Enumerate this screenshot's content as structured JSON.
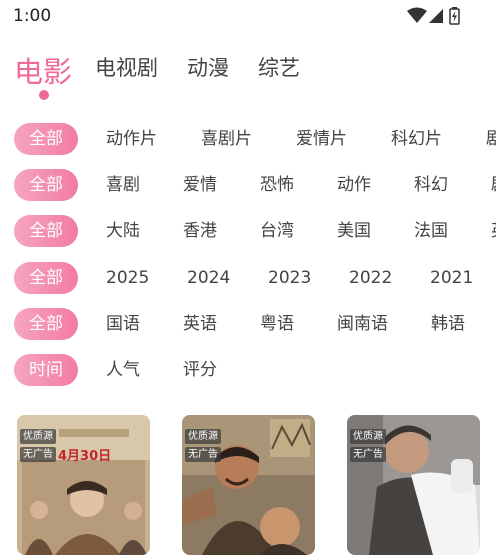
{
  "status_bar": {
    "time": "1:00"
  },
  "category_tabs": [
    {
      "label": "电影",
      "active": true
    },
    {
      "label": "电视剧"
    },
    {
      "label": "动漫"
    },
    {
      "label": "综艺"
    }
  ],
  "filters": [
    {
      "chip": "全部",
      "options": [
        "动作片",
        "喜剧片",
        "爱情片",
        "科幻片",
        "剧"
      ]
    },
    {
      "chip": "全部",
      "options": [
        "喜剧",
        "爱情",
        "恐怖",
        "动作",
        "科幻",
        "剧"
      ]
    },
    {
      "chip": "全部",
      "options": [
        "大陆",
        "香港",
        "台湾",
        "美国",
        "法国",
        "英"
      ]
    },
    {
      "chip": "全部",
      "options": [
        "2025",
        "2024",
        "2023",
        "2022",
        "2021"
      ]
    },
    {
      "chip": "全部",
      "options": [
        "国语",
        "英语",
        "粤语",
        "闽南语",
        "韩语"
      ]
    },
    {
      "chip": "时间",
      "options": [
        "人气",
        "评分"
      ]
    }
  ],
  "movies": [
    {
      "badges": [
        "优质源",
        "无广告"
      ],
      "poster_text": "4月30日"
    },
    {
      "badges": [
        "优质源",
        "无广告"
      ]
    },
    {
      "badges": [
        "优质源",
        "无广告"
      ]
    }
  ],
  "colors": {
    "accent": "#f06a96",
    "chip_start": "#f6a5bf",
    "chip_end": "#f27ba2"
  }
}
